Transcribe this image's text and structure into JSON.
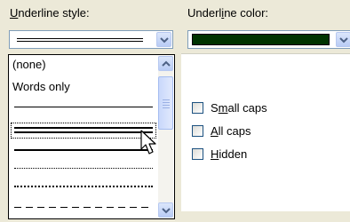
{
  "underline_style": {
    "label": "Underline style:",
    "label_accesskey": "U",
    "label_rest": "nderline style:",
    "current_value": "double-line",
    "options": [
      {
        "label": "(none)",
        "kind": "text"
      },
      {
        "label": "Words only",
        "kind": "text"
      },
      {
        "label": "",
        "kind": "single-line"
      },
      {
        "label": "",
        "kind": "double-line",
        "selected": true
      },
      {
        "label": "",
        "kind": "thick-line"
      },
      {
        "label": "",
        "kind": "dotted"
      },
      {
        "label": "",
        "kind": "thick-dotted"
      },
      {
        "label": "",
        "kind": "dashed"
      }
    ]
  },
  "underline_color": {
    "label": "Underline color:",
    "label_before": "Underl",
    "label_accesskey": "i",
    "label_after": "ne color:",
    "value_color": "#003300"
  },
  "effects": {
    "small_caps": {
      "pre": "S",
      "key": "m",
      "post": "all caps",
      "checked": false
    },
    "all_caps": {
      "pre": "",
      "key": "A",
      "post": "ll caps",
      "checked": false
    },
    "hidden": {
      "pre": "",
      "key": "H",
      "post": "idden",
      "checked": false
    }
  },
  "icons": {
    "dropdown": "chevron-down-icon",
    "scroll_up": "chevron-up-icon",
    "scroll_down": "chevron-down-icon",
    "cursor": "mouse-pointer-icon"
  },
  "colors": {
    "dialog_bg": "#ece9d8",
    "border": "#7f9db9",
    "button_gradient_top": "#dbe6fb",
    "button_gradient_bottom": "#b9ccf5",
    "arrow": "#4d6185"
  }
}
